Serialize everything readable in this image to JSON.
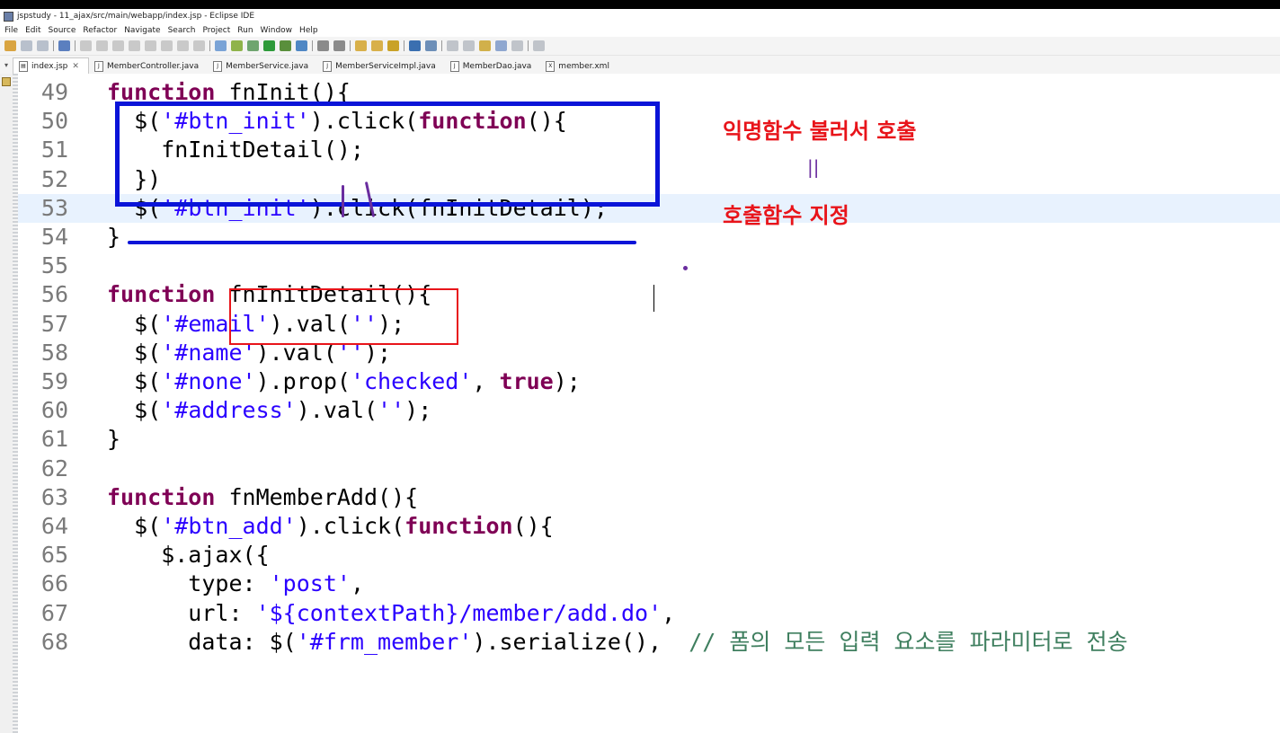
{
  "window": {
    "title": "jspstudy - 11_ajax/src/main/webapp/index.jsp - Eclipse IDE"
  },
  "menu": [
    "File",
    "Edit",
    "Source",
    "Refactor",
    "Navigate",
    "Search",
    "Project",
    "Run",
    "Window",
    "Help"
  ],
  "tabs": [
    {
      "label": "index.jsp",
      "active": true,
      "icon": "jsp-file-icon"
    },
    {
      "label": "MemberController.java",
      "active": false,
      "icon": "java-file-icon"
    },
    {
      "label": "MemberService.java",
      "active": false,
      "icon": "java-file-icon"
    },
    {
      "label": "MemberServiceImpl.java",
      "active": false,
      "icon": "java-file-icon"
    },
    {
      "label": "MemberDao.java",
      "active": false,
      "icon": "java-file-icon"
    },
    {
      "label": "member.xml",
      "active": false,
      "icon": "xml-file-icon"
    }
  ],
  "editor": {
    "current_line": 53,
    "lines": [
      {
        "n": "49",
        "segs": [
          [
            "kw",
            "function"
          ],
          [
            "n",
            " fnInit(){"
          ]
        ]
      },
      {
        "n": "50",
        "segs": [
          [
            "n",
            "  $("
          ],
          [
            "str",
            "'#btn_init'"
          ],
          [
            "n",
            ").click("
          ],
          [
            "kw",
            "function"
          ],
          [
            "n",
            "(){"
          ]
        ]
      },
      {
        "n": "51",
        "segs": [
          [
            "n",
            "    fnInitDetail();"
          ]
        ]
      },
      {
        "n": "52",
        "segs": [
          [
            "n",
            "  })"
          ]
        ]
      },
      {
        "n": "53",
        "segs": [
          [
            "n",
            "  $("
          ],
          [
            "str",
            "'#btn_init'"
          ],
          [
            "n",
            ").click(fnInitDetail);"
          ]
        ]
      },
      {
        "n": "54",
        "segs": [
          [
            "n",
            "}"
          ]
        ]
      },
      {
        "n": "55",
        "segs": []
      },
      {
        "n": "56",
        "segs": [
          [
            "kw",
            "function"
          ],
          [
            "n",
            " fnInitDetail(){"
          ]
        ]
      },
      {
        "n": "57",
        "segs": [
          [
            "n",
            "  $("
          ],
          [
            "str",
            "'#email'"
          ],
          [
            "n",
            ").val("
          ],
          [
            "str",
            "''"
          ],
          [
            "n",
            ");"
          ]
        ]
      },
      {
        "n": "58",
        "segs": [
          [
            "n",
            "  $("
          ],
          [
            "str",
            "'#name'"
          ],
          [
            "n",
            ").val("
          ],
          [
            "str",
            "''"
          ],
          [
            "n",
            ");"
          ]
        ]
      },
      {
        "n": "59",
        "segs": [
          [
            "n",
            "  $("
          ],
          [
            "str",
            "'#none'"
          ],
          [
            "n",
            ").prop("
          ],
          [
            "str",
            "'checked'"
          ],
          [
            "n",
            ", "
          ],
          [
            "kw",
            "true"
          ],
          [
            "n",
            ");"
          ]
        ]
      },
      {
        "n": "60",
        "segs": [
          [
            "n",
            "  $("
          ],
          [
            "str",
            "'#address'"
          ],
          [
            "n",
            ").val("
          ],
          [
            "str",
            "''"
          ],
          [
            "n",
            ");"
          ]
        ]
      },
      {
        "n": "61",
        "segs": [
          [
            "n",
            "}"
          ]
        ]
      },
      {
        "n": "62",
        "segs": []
      },
      {
        "n": "63",
        "segs": [
          [
            "kw",
            "function"
          ],
          [
            "n",
            " fnMemberAdd(){"
          ]
        ]
      },
      {
        "n": "64",
        "segs": [
          [
            "n",
            "  $("
          ],
          [
            "str",
            "'#btn_add'"
          ],
          [
            "n",
            ").click("
          ],
          [
            "kw",
            "function"
          ],
          [
            "n",
            "(){"
          ]
        ]
      },
      {
        "n": "65",
        "segs": [
          [
            "n",
            "    $.ajax({"
          ]
        ]
      },
      {
        "n": "66",
        "segs": [
          [
            "n",
            "      type: "
          ],
          [
            "str",
            "'post'"
          ],
          [
            "n",
            ","
          ]
        ]
      },
      {
        "n": "67",
        "segs": [
          [
            "n",
            "      url: "
          ],
          [
            "str",
            "'${contextPath}/member/add.do'"
          ],
          [
            "n",
            ","
          ]
        ]
      },
      {
        "n": "68",
        "segs": [
          [
            "n",
            "      data: $("
          ],
          [
            "str",
            "'#frm_member'"
          ],
          [
            "n",
            ").serialize(),  "
          ],
          [
            "cmt",
            "// 폼의 모든 입력 요소를 파라미터로 전송"
          ]
        ]
      }
    ]
  },
  "annotations": {
    "anonymous_call": "익명함수 불러서 호출",
    "equals_mark": "||",
    "callback_designate": "호출함수 지정"
  },
  "colors": {
    "keyword": "#7f0055",
    "string": "#2a00ff",
    "comment": "#3f7f5f",
    "line_number": "#7a7a7a",
    "current_line": "#e8f2fe",
    "annotation_red": "#e8141a",
    "annotation_blue": "#0a14d8",
    "scribble_purple": "#6a2d9f"
  }
}
